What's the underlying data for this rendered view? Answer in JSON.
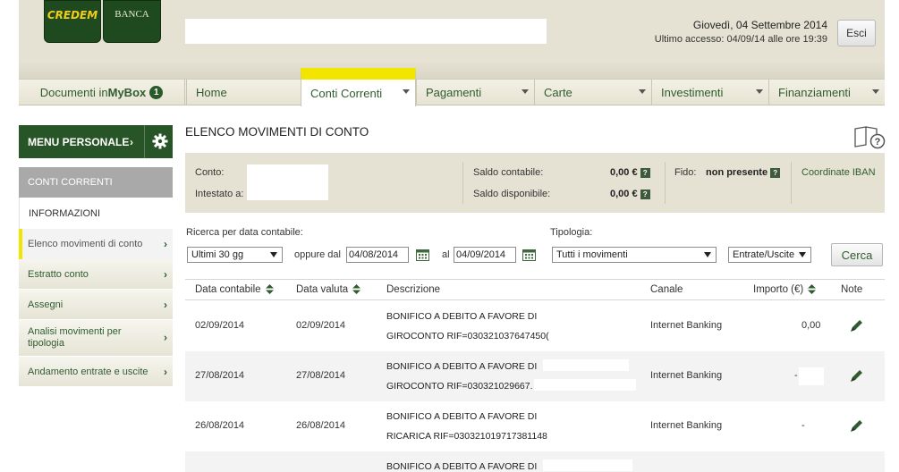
{
  "header": {
    "logo_left": "CREDEM",
    "logo_right": "BANCA",
    "date_line": "Giovedì, 04 Settembre 2014",
    "last_access": "Ultimo accesso: 04/09/14 alle ore 19:39",
    "logout_label": "Esci"
  },
  "nav": {
    "mybox_prefix": "Documenti in",
    "mybox_bold": "MyBox",
    "mybox_count": "1",
    "tabs": [
      {
        "label": "Home"
      },
      {
        "label": "Conti Correnti"
      },
      {
        "label": "Pagamenti"
      },
      {
        "label": "Carte"
      },
      {
        "label": "Investimenti"
      },
      {
        "label": "Finanziamenti"
      }
    ]
  },
  "sidebar": {
    "menu_personale": "MENU PERSONALE",
    "section": "CONTI CORRENTI",
    "items": [
      {
        "label": "INFORMAZIONI"
      },
      {
        "label": "Elenco movimenti di conto"
      },
      {
        "label": "Estratto conto"
      },
      {
        "label": "Assegni"
      },
      {
        "label": "Analisi movimenti per tipologia"
      },
      {
        "label": "Andamento entrate e uscite"
      }
    ]
  },
  "main": {
    "title": "ELENCO MOVIMENTI DI CONTO",
    "account": {
      "conto_label": "Conto:",
      "intestato_label": "Intestato a:",
      "saldo_contabile_label": "Saldo contabile:",
      "saldo_contabile_value": "0,00 €",
      "saldo_disponibile_label": "Saldo disponibile:",
      "saldo_disponibile_value": "0,00 €",
      "fido_label": "Fido:",
      "fido_value": "non presente",
      "iban_link": "Coordinate IBAN"
    },
    "filters": {
      "ricerca_label": "Ricerca per data contabile:",
      "period_value": "Ultimi 30 gg",
      "oppure_label": "oppure dal",
      "from_date": "04/08/2014",
      "al_label": "al",
      "to_date": "04/09/2014",
      "tipologia_label": "Tipologia:",
      "tipologia_value": "Tutti i movimenti",
      "direction_value": "Entrate/Uscite",
      "search_button": "Cerca"
    },
    "table": {
      "headers": {
        "data_contabile": "Data contabile",
        "data_valuta": "Data valuta",
        "descrizione": "Descrizione",
        "canale": "Canale",
        "importo": "Importo (€)",
        "note": "Note"
      },
      "rows": [
        {
          "data_contabile": "02/09/2014",
          "data_valuta": "02/09/2014",
          "desc1": "BONIFICO A DEBITO A FAVORE DI",
          "desc2": "GIROCONTO RIF=030321037647450(",
          "canale": "Internet Banking",
          "importo": "0,00"
        },
        {
          "data_contabile": "27/08/2014",
          "data_valuta": "27/08/2014",
          "desc1": "BONIFICO A DEBITO A FAVORE DI",
          "desc2": "GIROCONTO RIF=030321029667.",
          "canale": "Internet Banking",
          "importo": "-"
        },
        {
          "data_contabile": "26/08/2014",
          "data_valuta": "26/08/2014",
          "desc1": "BONIFICO A DEBITO A FAVORE DI",
          "desc2": "RICARICA RIF=03032101971738114​8",
          "canale": "Internet Banking",
          "importo": "-"
        },
        {
          "data_contabile": "",
          "data_valuta": "",
          "desc1": "BONIFICO A DEBITO A FAVORE DI",
          "desc2": "",
          "canale": "",
          "importo": ""
        }
      ]
    }
  },
  "colors": {
    "brand_green": "#275527",
    "brand_yellow": "#f2e500",
    "header_beige": "#e5e2d3"
  }
}
